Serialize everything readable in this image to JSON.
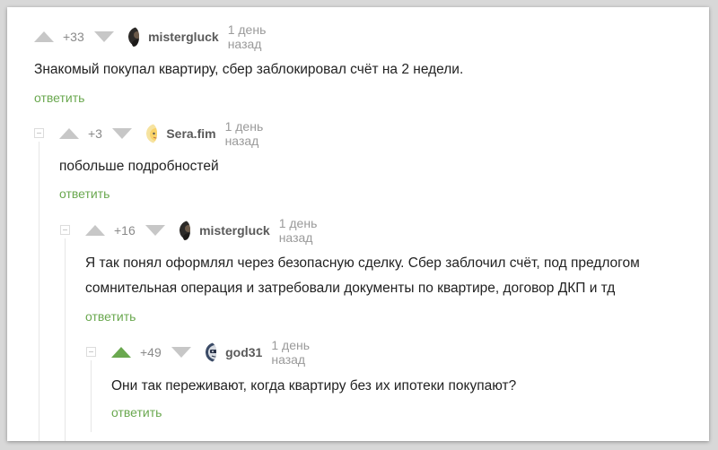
{
  "comments": [
    {
      "score": "+33",
      "author": "mistergluck",
      "time": "1 день назад",
      "text_lines": [
        "Знакомый покупал квартиру, сбер заблокировал счёт на 2 недели."
      ],
      "reply": "ответить",
      "upvoted": false,
      "avatar_icon": "person-dark-avatar"
    },
    {
      "score": "+3",
      "author": "Sera.fim",
      "time": "1 день назад",
      "text_lines": [
        "побольше подробностей"
      ],
      "reply": "ответить",
      "upvoted": false,
      "avatar_icon": "cartoon-face-avatar"
    },
    {
      "score": "+16",
      "author": "mistergluck",
      "time": "1 день назад",
      "text_lines": [
        "Я так понял оформлял через безопасную сделку. Сбер заблочил счёт, под предлогом",
        "сомнительная операция и затребовали документы по квартире, договор ДКП и тд"
      ],
      "reply": "ответить",
      "upvoted": false,
      "avatar_icon": "person-dark-avatar"
    },
    {
      "score": "+49",
      "author": "god31",
      "time": "1 день назад",
      "text_lines": [
        "Они так переживают, когда квартиру без их ипотеки покупают?"
      ],
      "reply": "ответить",
      "upvoted": true,
      "avatar_icon": "mask-avatar"
    }
  ],
  "colors": {
    "vote_inactive": "#c7c7c7",
    "vote_active": "#6aa84f",
    "reply_link": "#6aa84f",
    "author": "#5a5a5a",
    "meta": "#9a9a9a"
  }
}
